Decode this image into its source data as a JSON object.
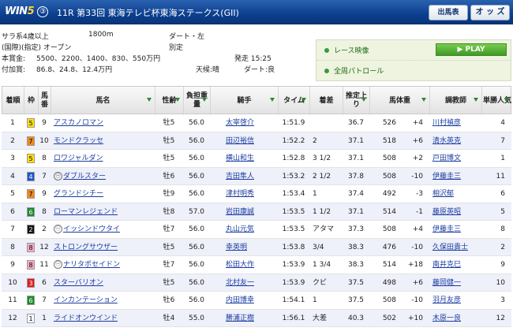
{
  "header": {
    "logo_prefix": "WIN",
    "logo_number": "5",
    "logo_circle": "③",
    "race_title": "11R 第33回 東海テレビ杯東海ステークス(GII)",
    "btn_card": "出馬表",
    "btn_odds": "オ ッ ズ"
  },
  "info": {
    "line1_a": "サラ系4歳以上",
    "line1_b": "1800m",
    "line1_c": "ダート・左",
    "line2_a": "(国際)(指定) オープン",
    "line2_c": "別定",
    "line3_a": "本賞金:",
    "line3_b": "5500、2200、1400、830、550万円",
    "line3_c": "発走 15:25",
    "line4_a": "付加賞:",
    "line4_b": "86.8、24.8、12.4万円",
    "line4_c": "天候:晴",
    "line4_d": "ダート:良"
  },
  "media": {
    "video_label": "レース映像",
    "play_label": "PLAY",
    "patrol_label": "全周パトロール"
  },
  "table": {
    "headers": {
      "order": "着順",
      "waku": "枠",
      "umaban": "馬番",
      "horse": "馬名",
      "sexage": "性齢",
      "weight_carried": "負担重量",
      "jockey": "騎手",
      "time": "タイム",
      "margin": "着差",
      "last3f": "推定上り",
      "body_weight": "馬体重",
      "trainer": "調教師",
      "popularity": "単勝人気"
    },
    "rows": [
      {
        "order": "1",
        "waku": "5",
        "umaban": "9",
        "mark": "",
        "horse": "アスカノロマン",
        "sexage": "牡5",
        "load": "56.0",
        "jockey": "太宰啓介",
        "time": "1:51.9",
        "margin": "",
        "last3f": "36.7",
        "bw": "526",
        "bwd": "+4",
        "trainer": "川村禎彦",
        "pop": "4"
      },
      {
        "order": "2",
        "waku": "7",
        "umaban": "10",
        "mark": "",
        "horse": "モンドクラッセ",
        "sexage": "牡5",
        "load": "56.0",
        "jockey": "田辺裕信",
        "time": "1:52.2",
        "margin": "2",
        "last3f": "37.1",
        "bw": "518",
        "bwd": "+6",
        "trainer": "清水英克",
        "pop": "7"
      },
      {
        "order": "3",
        "waku": "5",
        "umaban": "8",
        "mark": "",
        "horse": "ロワジャルダン",
        "sexage": "牡5",
        "load": "56.0",
        "jockey": "横山和生",
        "time": "1:52.8",
        "margin": "3 1/2",
        "last3f": "37.1",
        "bw": "508",
        "bwd": "+2",
        "trainer": "戸田博文",
        "pop": "1"
      },
      {
        "order": "4",
        "waku": "4",
        "umaban": "7",
        "mark": "㊀",
        "horse": "ダブルスター",
        "sexage": "牡6",
        "load": "56.0",
        "jockey": "吉田隼人",
        "time": "1:53.2",
        "margin": "2 1/2",
        "last3f": "37.8",
        "bw": "508",
        "bwd": "-10",
        "trainer": "伊藤圭三",
        "pop": "11"
      },
      {
        "order": "5",
        "waku": "7",
        "umaban": "9",
        "mark": "",
        "horse": "グランドシチー",
        "sexage": "牡9",
        "load": "56.0",
        "jockey": "津村明秀",
        "time": "1:53.4",
        "margin": "1",
        "last3f": "37.4",
        "bw": "492",
        "bwd": "-3",
        "trainer": "相沢郁",
        "pop": "6"
      },
      {
        "order": "6",
        "waku": "6",
        "umaban": "8",
        "mark": "",
        "horse": "ローマンレジェンド",
        "sexage": "牡8",
        "load": "57.0",
        "jockey": "岩田康誠",
        "time": "1:53.5",
        "margin": "1 1/2",
        "last3f": "37.1",
        "bw": "514",
        "bwd": "-1",
        "trainer": "藤原英昭",
        "pop": "5"
      },
      {
        "order": "7",
        "waku": "2",
        "umaban": "2",
        "mark": "㊀",
        "horse": "イッシンドウタイ",
        "sexage": "牡7",
        "load": "56.0",
        "jockey": "丸山元気",
        "time": "1:53.5",
        "margin": "アタマ",
        "last3f": "37.3",
        "bw": "508",
        "bwd": "+4",
        "trainer": "伊藤圭三",
        "pop": "8"
      },
      {
        "order": "8",
        "waku": "8",
        "umaban": "12",
        "mark": "",
        "horse": "ストロングサウザー",
        "sexage": "牡5",
        "load": "56.0",
        "jockey": "幸英明",
        "time": "1:53.8",
        "margin": "3/4",
        "last3f": "38.3",
        "bw": "476",
        "bwd": "-10",
        "trainer": "久保田貴士",
        "pop": "2"
      },
      {
        "order": "9",
        "waku": "8",
        "umaban": "11",
        "mark": "㊀",
        "horse": "ナリタポセイドン",
        "sexage": "牡7",
        "load": "56.0",
        "jockey": "松田大作",
        "time": "1:53.9",
        "margin": "1 3/4",
        "last3f": "38.3",
        "bw": "514",
        "bwd": "+18",
        "trainer": "南井克巳",
        "pop": "9"
      },
      {
        "order": "10",
        "waku": "3",
        "umaban": "6",
        "mark": "",
        "horse": "スターバリオン",
        "sexage": "牡5",
        "load": "56.0",
        "jockey": "北村友一",
        "time": "1:53.9",
        "margin": "クビ",
        "last3f": "37.5",
        "bw": "498",
        "bwd": "+6",
        "trainer": "藤岡健一",
        "pop": "10"
      },
      {
        "order": "11",
        "waku": "6",
        "umaban": "7",
        "mark": "",
        "horse": "インカンテーション",
        "sexage": "牡6",
        "load": "56.0",
        "jockey": "内田博幸",
        "time": "1:54.1",
        "margin": "1",
        "last3f": "37.5",
        "bw": "508",
        "bwd": "-10",
        "trainer": "羽月友彦",
        "pop": "3"
      },
      {
        "order": "12",
        "waku": "1",
        "umaban": "1",
        "mark": "",
        "horse": "ライドオンウインド",
        "sexage": "牡4",
        "load": "55.0",
        "jockey": "勝浦正樹",
        "time": "1:56.1",
        "margin": "大差",
        "last3f": "40.3",
        "bw": "502",
        "bwd": "+10",
        "trainer": "木原一良",
        "pop": "12"
      }
    ]
  },
  "colors": {
    "header_bg": "#0c3f8f",
    "row_alt": "#eef0fa",
    "link": "#1a3ca0",
    "waku": {
      "1": {
        "bg": "#ffffff",
        "fg": "#000000"
      },
      "2": {
        "bg": "#111111",
        "fg": "#ffffff"
      },
      "3": {
        "bg": "#e21b1b",
        "fg": "#ffffff"
      },
      "4": {
        "bg": "#1e56c8",
        "fg": "#ffffff"
      },
      "5": {
        "bg": "#ffe100",
        "fg": "#000000"
      },
      "6": {
        "bg": "#1a8a2a",
        "fg": "#ffffff"
      },
      "7": {
        "bg": "#f08a1c",
        "fg": "#000000"
      },
      "8": {
        "bg": "#f7a9c4",
        "fg": "#000000"
      }
    }
  }
}
